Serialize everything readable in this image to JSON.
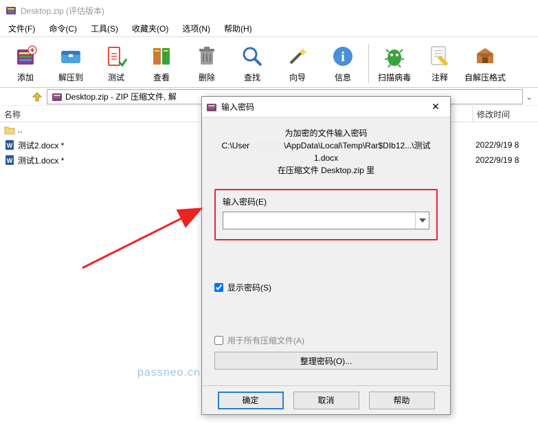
{
  "window": {
    "title": "Desktop.zip (评估版本)"
  },
  "menubar": {
    "file": "文件(F)",
    "command": "命令(C)",
    "tool": "工具(S)",
    "favorite": "收藏夹(O)",
    "option": "选项(N)",
    "help": "帮助(H)"
  },
  "toolbar": {
    "add": "添加",
    "extract": "解压到",
    "test": "测试",
    "view": "查看",
    "delete": "删除",
    "find": "查找",
    "wizard": "向导",
    "info": "信息",
    "scan": "扫描病毒",
    "comment": "注释",
    "sfx": "自解压格式"
  },
  "pathbar": {
    "text": "Desktop.zip - ZIP 压缩文件, 解"
  },
  "list": {
    "header": {
      "name": "名称",
      "mtime": "修改时间"
    },
    "rows": [
      {
        "icon": "folder",
        "name": "..",
        "mtime": ""
      },
      {
        "icon": "docx",
        "name": "测试2.docx *",
        "mtime": "2022/9/19 8"
      },
      {
        "icon": "docx",
        "name": "测试1.docx *",
        "mtime": "2022/9/19 8"
      }
    ]
  },
  "dialog": {
    "title": "输入密码",
    "info_line1": "为加密的文件输入密码",
    "info_line2a": "C:\\User",
    "info_line2b": "\\AppData\\Local\\Temp\\Rar$DIb12...\\测试1.docx",
    "info_line3": "在压缩文件 Desktop.zip 里",
    "pwd_label": "输入密码(E)",
    "pwd_value": "",
    "show_pwd_label": "显示密码(S)",
    "show_pwd_checked": true,
    "all_label": "用于所有压缩文件(A)",
    "all_checked": false,
    "organize": "整理密码(O)...",
    "ok": "确定",
    "cancel": "取消",
    "help": "帮助"
  },
  "watermark": "passneo.cn"
}
